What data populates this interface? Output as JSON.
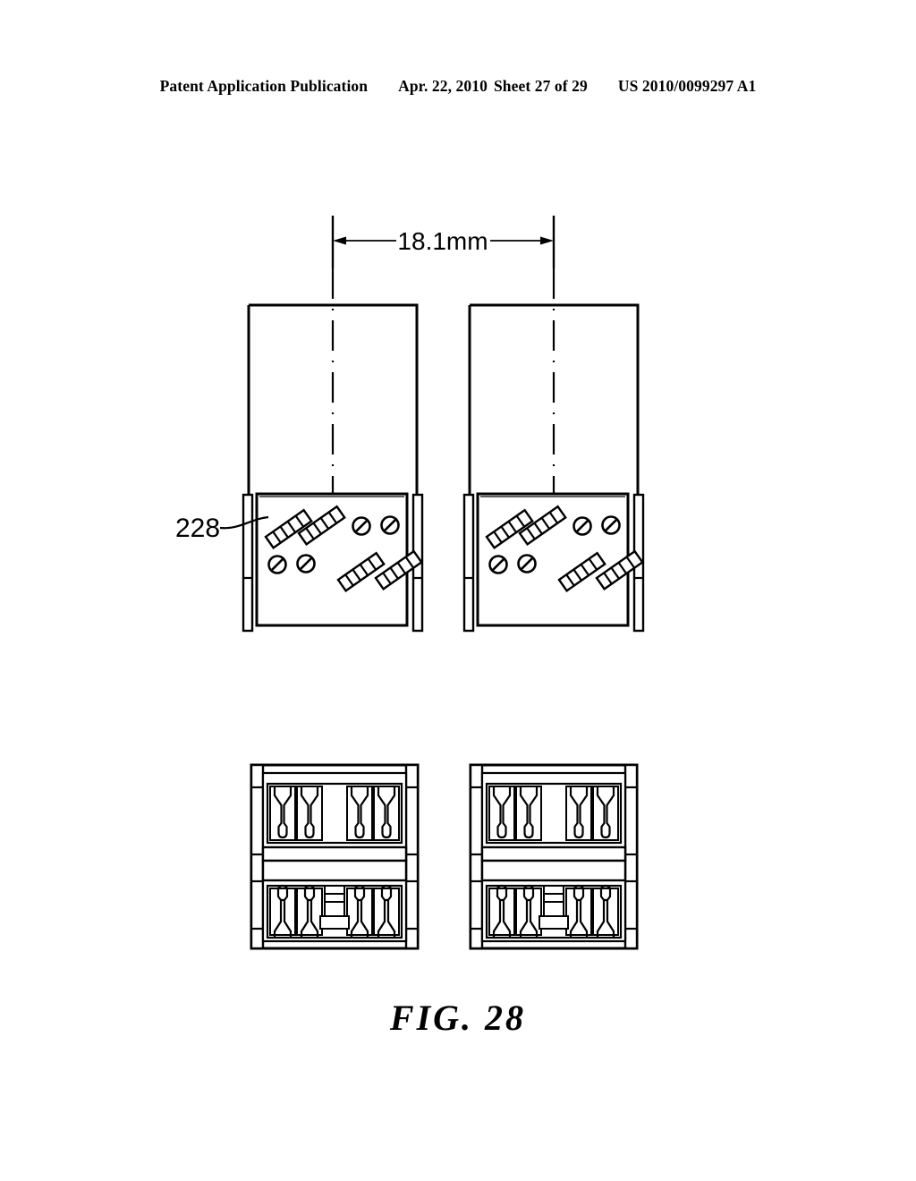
{
  "header": {
    "publication_label": "Patent Application Publication",
    "date": "Apr. 22, 2010",
    "sheet": "Sheet 27 of 29",
    "document_number": "US 2010/0099297 A1"
  },
  "figure": {
    "caption": "FIG.  28",
    "dimension_label": "18.1mm",
    "reference_numerals": [
      {
        "id": "228",
        "label": "228"
      }
    ],
    "views": [
      {
        "name": "front-view-left",
        "centerline": true,
        "detail_panel": {
          "components": [
            {
              "type": "hatched-bar",
              "angle": -35
            },
            {
              "type": "hatched-bar",
              "angle": -35
            },
            {
              "type": "hatched-bar",
              "angle": -35
            },
            {
              "type": "hatched-bar",
              "angle": -35
            },
            {
              "type": "slotted-circle"
            },
            {
              "type": "slotted-circle"
            },
            {
              "type": "slotted-circle"
            },
            {
              "type": "slotted-circle"
            }
          ]
        }
      },
      {
        "name": "front-view-right",
        "centerline": true,
        "detail_panel": {
          "components": [
            {
              "type": "hatched-bar",
              "angle": -35
            },
            {
              "type": "hatched-bar",
              "angle": -35
            },
            {
              "type": "hatched-bar",
              "angle": -35
            },
            {
              "type": "hatched-bar",
              "angle": -35
            },
            {
              "type": "slotted-circle"
            },
            {
              "type": "slotted-circle"
            },
            {
              "type": "slotted-circle"
            },
            {
              "type": "slotted-circle"
            }
          ]
        }
      },
      {
        "name": "bottom-view-left",
        "upper_contacts": 4,
        "lower_contacts": 4
      },
      {
        "name": "bottom-view-right",
        "upper_contacts": 4,
        "lower_contacts": 4
      }
    ]
  },
  "colors": {
    "ink": "#000000",
    "paper": "#ffffff"
  }
}
